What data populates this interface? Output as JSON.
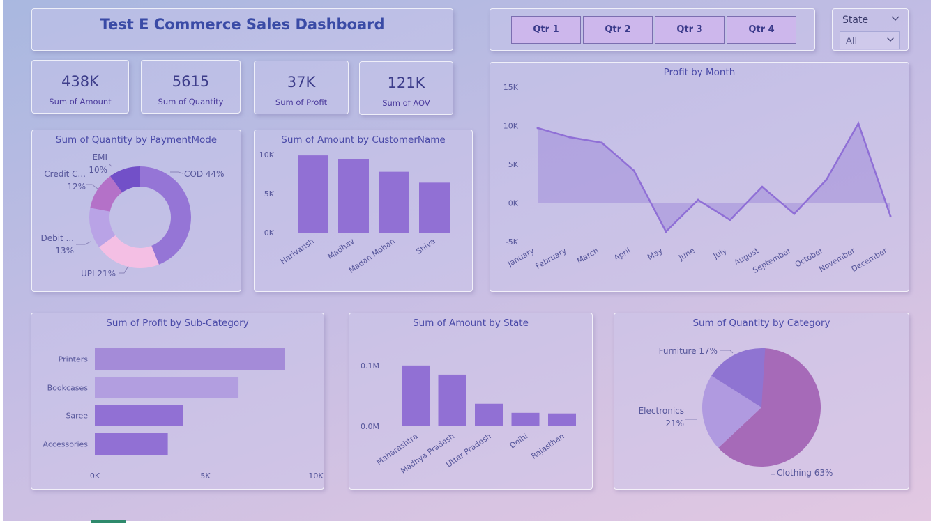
{
  "dashboard": {
    "title": "Test E Commerce Sales Dashboard"
  },
  "quarter_buttons": [
    {
      "label": "Qtr 1"
    },
    {
      "label": "Qtr 2"
    },
    {
      "label": "Qtr 3"
    },
    {
      "label": "Qtr 4"
    }
  ],
  "state_slicer": {
    "title": "State",
    "value": "All"
  },
  "kpis": [
    {
      "value": "438K",
      "label": "Sum of Amount"
    },
    {
      "value": "5615",
      "label": "Sum of Quantity"
    },
    {
      "value": "37K",
      "label": "Sum of Profit"
    },
    {
      "value": "121K",
      "label": "Sum of AOV"
    }
  ],
  "colors": {
    "bar": "#9170d4",
    "bar_light": "#a58ed8",
    "title": "#4a4aa8",
    "button": "#cdb7ec"
  },
  "chart_data": [
    {
      "id": "payment",
      "type": "pie",
      "title": "Sum of Quantity by PaymentMode",
      "donut": true,
      "slices": [
        {
          "name": "COD",
          "percent": 44,
          "label": "COD 44%",
          "color": "#9575d6"
        },
        {
          "name": "UPI",
          "percent": 21,
          "label": "UPI 21%",
          "color": "#f4bfe4"
        },
        {
          "name": "Debit ...",
          "percent": 13,
          "label": "Debit ...\n13%",
          "color": "#b9a3e6"
        },
        {
          "name": "Credit C...",
          "percent": 12,
          "label": "Credit C...\n12%",
          "color": "#b471c8"
        },
        {
          "name": "EMI",
          "percent": 10,
          "label": "EMI\n10%",
          "color": "#7250c8"
        }
      ]
    },
    {
      "id": "customer",
      "type": "bar",
      "title": "Sum of Amount by CustomerName",
      "categories": [
        "Harivansh",
        "Madhav",
        "Madan Mohan",
        "Shiva"
      ],
      "values": [
        9900,
        9400,
        7800,
        6400
      ],
      "yticks": [
        {
          "v": 0,
          "t": "0K"
        },
        {
          "v": 5000,
          "t": "5K"
        },
        {
          "v": 10000,
          "t": "10K"
        }
      ],
      "ylim": [
        0,
        10000
      ]
    },
    {
      "id": "month",
      "type": "area",
      "title": "Profit by Month",
      "categories": [
        "January",
        "February",
        "March",
        "April",
        "May",
        "June",
        "July",
        "August",
        "September",
        "October",
        "November",
        "December"
      ],
      "values": [
        9700,
        8500,
        7800,
        4200,
        -3700,
        400,
        -2200,
        2100,
        -1400,
        3000,
        10300,
        -1700
      ],
      "yticks": [
        {
          "v": -5000,
          "t": "-5K"
        },
        {
          "v": 0,
          "t": "0K"
        },
        {
          "v": 5000,
          "t": "5K"
        },
        {
          "v": 10000,
          "t": "10K"
        },
        {
          "v": 15000,
          "t": "15K"
        }
      ],
      "ylim": [
        -5000,
        15000
      ]
    },
    {
      "id": "subcat",
      "type": "bar",
      "orientation": "horizontal",
      "title": "Sum of Profit by Sub-Category",
      "categories": [
        "Printers",
        "Bookcases",
        "Saree",
        "Accessories"
      ],
      "values": [
        8600,
        6500,
        4000,
        3300
      ],
      "xticks": [
        {
          "v": 0,
          "t": "0K"
        },
        {
          "v": 5000,
          "t": "5K"
        },
        {
          "v": 10000,
          "t": "10K"
        }
      ],
      "xlim": [
        0,
        10000
      ]
    },
    {
      "id": "state",
      "type": "bar",
      "title": "Sum of Amount by State",
      "categories": [
        "Maharashtra",
        "Madhya Pradesh",
        "Uttar Pradesh",
        "Delhi",
        "Rajasthan"
      ],
      "values": [
        0.1,
        0.085,
        0.037,
        0.022,
        0.021
      ],
      "yticks": [
        {
          "v": 0,
          "t": "0.0M"
        },
        {
          "v": 0.1,
          "t": "0.1M"
        }
      ],
      "ylim": [
        0,
        0.14
      ]
    },
    {
      "id": "category",
      "type": "pie",
      "title": "Sum of Quantity by Category",
      "slices": [
        {
          "name": "Clothing",
          "percent": 63,
          "label": "Clothing 63%",
          "color": "#a66ab8"
        },
        {
          "name": "Electronics",
          "percent": 21,
          "label": "Electronics\n21%",
          "color": "#b09ae0"
        },
        {
          "name": "Furniture",
          "percent": 17,
          "label": "Furniture 17%",
          "color": "#8f74d2"
        }
      ]
    }
  ]
}
